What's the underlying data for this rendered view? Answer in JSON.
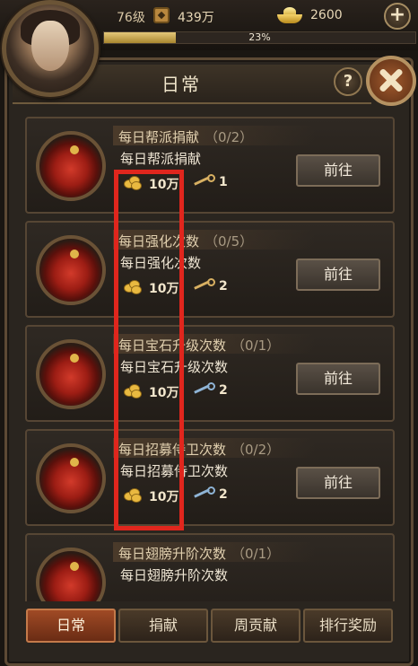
{
  "player": {
    "level": "76级",
    "gold": "439万",
    "ingots": "2600",
    "exp_percent_text": "23%",
    "exp_fraction": 0.23
  },
  "panel": {
    "title": "日常",
    "help_label": "?"
  },
  "tasks": [
    {
      "name": "每日帮派捐献",
      "progress": "（0/2）",
      "desc": "每日帮派捐献",
      "coin": "10万",
      "keys": "1",
      "key_color": "#d8b062",
      "button": "前往"
    },
    {
      "name": "每日强化次数",
      "progress": "（0/5）",
      "desc": "每日强化次数",
      "coin": "10万",
      "keys": "2",
      "key_color": "#d8b062",
      "button": "前往"
    },
    {
      "name": "每日宝石升级次数",
      "progress": "（0/1）",
      "desc": "每日宝石升级次数",
      "coin": "10万",
      "keys": "2",
      "key_color": "#8fb4d6",
      "button": "前往"
    },
    {
      "name": "每日招募侍卫次数",
      "progress": "（0/2）",
      "desc": "每日招募侍卫次数",
      "coin": "10万",
      "keys": "2",
      "key_color": "#8fb4d6",
      "button": "前往"
    },
    {
      "name": "每日翅膀升阶次数",
      "progress": "（0/1）",
      "desc": "每日翅膀升阶次数",
      "coin": "",
      "keys": "",
      "key_color": "#8fb4d6",
      "button": ""
    }
  ],
  "tabs": [
    {
      "label": "日常",
      "active": true
    },
    {
      "label": "捐献",
      "active": false
    },
    {
      "label": "周贡献",
      "active": false
    },
    {
      "label": "排行奖励",
      "active": false
    }
  ],
  "colors": {
    "highlight": "#e0261d",
    "active_tab": "#a04a25"
  }
}
